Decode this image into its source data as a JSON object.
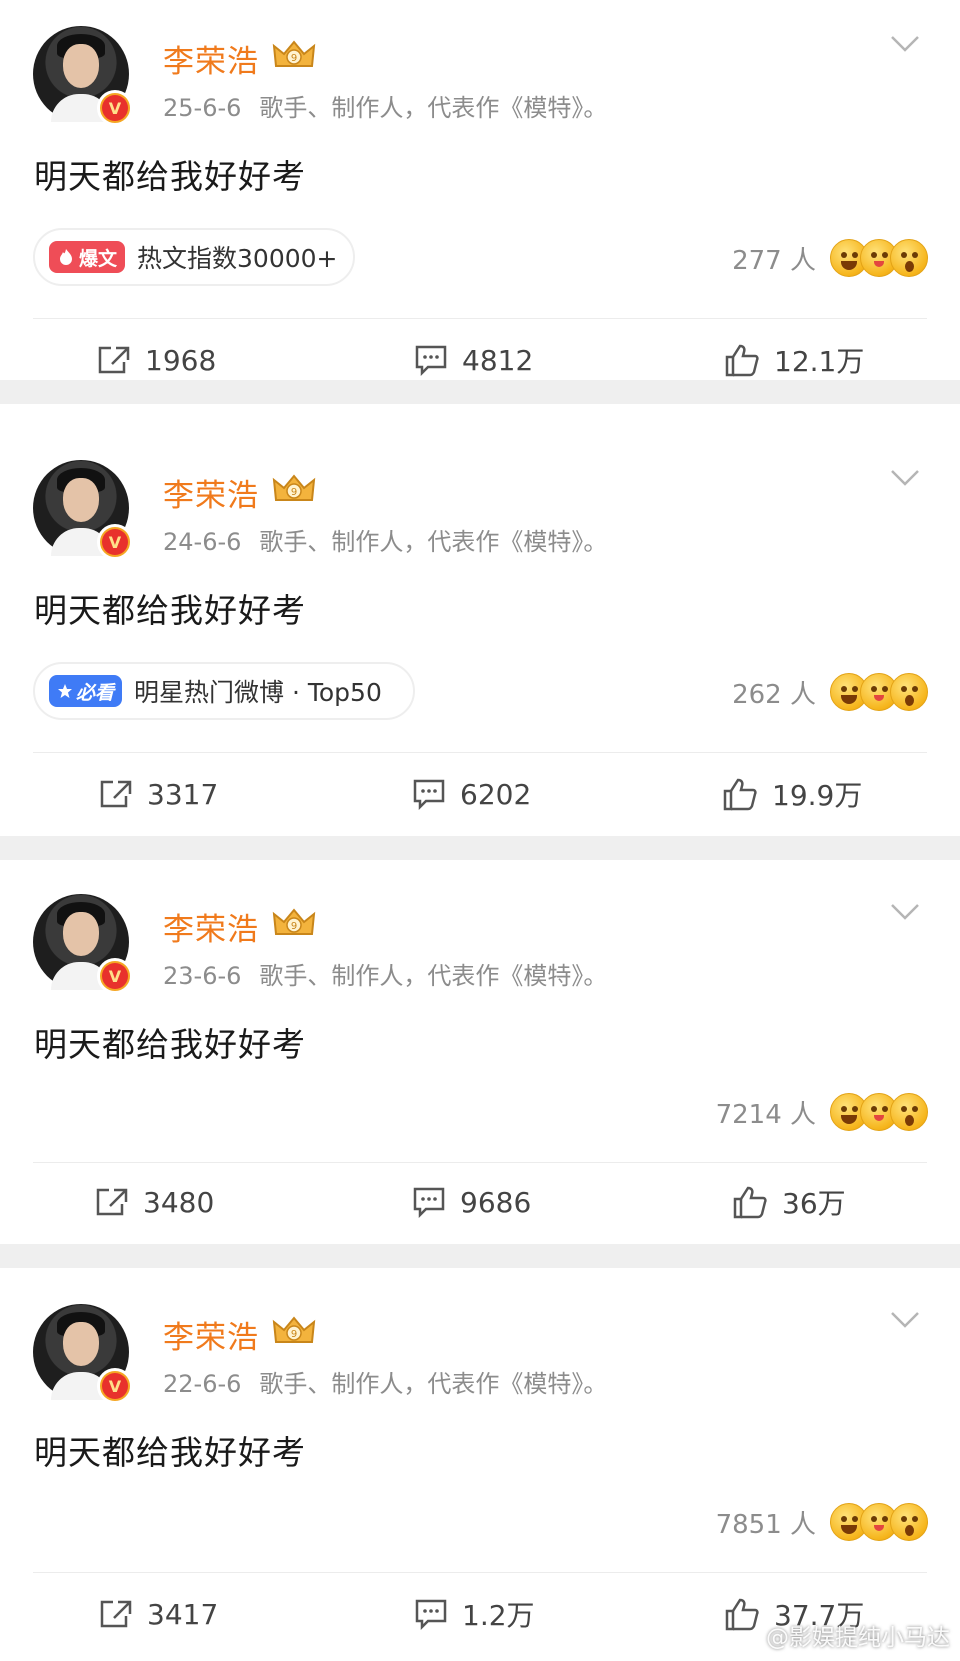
{
  "theme": {
    "name_color": "#f07a1c",
    "meta_color": "#8c8c8c",
    "hot_tag_color": "#ef4d57",
    "star_tag_color": "#3f7bf6",
    "page_bg": "#efefef"
  },
  "posts": [
    {
      "author": "李荣浩",
      "date": "25-6-6",
      "bio": "歌手、制作人，代表作《模特》。",
      "text": "明天都给我好好考",
      "tag": {
        "badge": "爆文",
        "label": "热文指数30000+"
      },
      "reactors": "277 人",
      "repost": "1968",
      "comment": "4812",
      "like": "12.1万"
    },
    {
      "author": "李荣浩",
      "date": "24-6-6",
      "bio": "歌手、制作人，代表作《模特》。",
      "text": "明天都给我好好考",
      "tag": {
        "badge": "必看",
        "label": "明星热门微博 · Top50"
      },
      "reactors": "262 人",
      "repost": "3317",
      "comment": "6202",
      "like": "19.9万"
    },
    {
      "author": "李荣浩",
      "date": "23-6-6",
      "bio": "歌手、制作人，代表作《模特》。",
      "text": "明天都给我好好考",
      "reactors": "7214 人",
      "repost": "3480",
      "comment": "9686",
      "like": "36万"
    },
    {
      "author": "李荣浩",
      "date": "22-6-6",
      "bio": "歌手、制作人，代表作《模特》。",
      "text": "明天都给我好好考",
      "reactors": "7851 人",
      "repost": "3417",
      "comment": "1.2万",
      "like": "37.7万"
    }
  ],
  "watermark": "@影娱提纯小马达"
}
